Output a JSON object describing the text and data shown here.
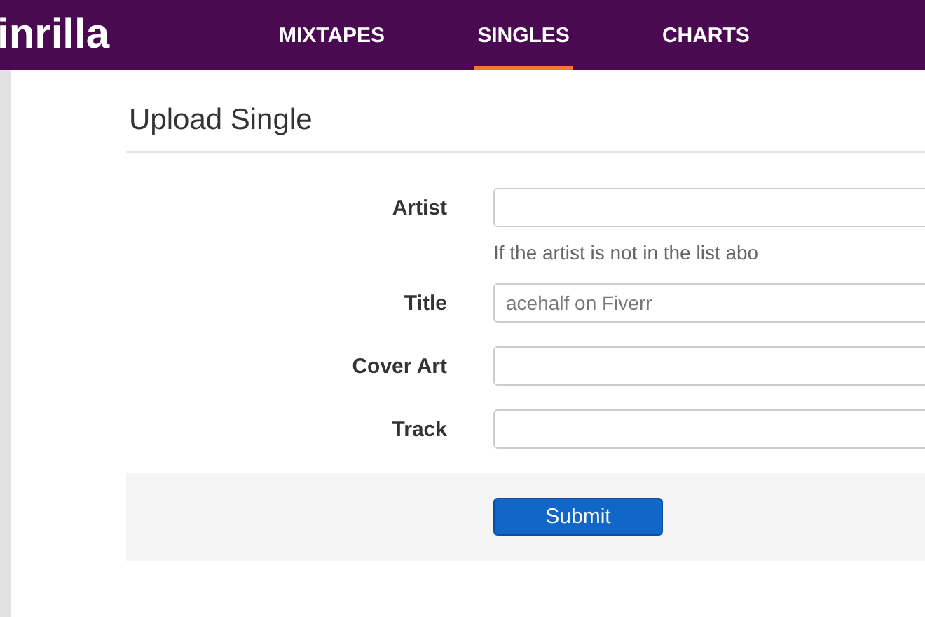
{
  "header": {
    "logo": "inrilla",
    "nav": [
      {
        "label": "MIXTAPES",
        "selected": false
      },
      {
        "label": "SINGLES",
        "selected": true
      },
      {
        "label": "CHARTS",
        "selected": false
      }
    ]
  },
  "form": {
    "title": "Upload Single",
    "fields": [
      {
        "label": "Artist",
        "help": "If the artist is not in the list abo"
      },
      {
        "label": "Title",
        "value": "acehalf on Fiverr"
      },
      {
        "label": "Cover Art"
      },
      {
        "label": "Track"
      }
    ],
    "submit": "Submit"
  }
}
